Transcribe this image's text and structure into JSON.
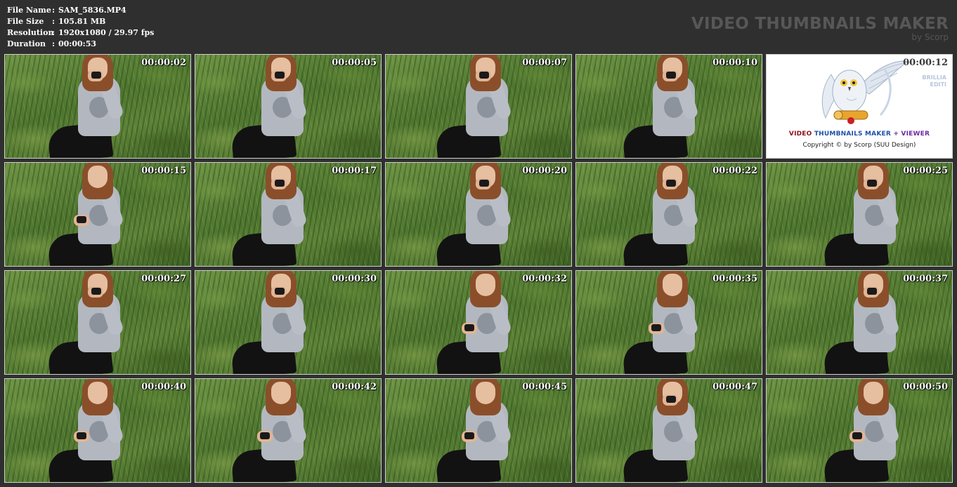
{
  "info": {
    "rows": [
      {
        "label": "File Name",
        "sep": ":",
        "value": "SAM_5836.MP4"
      },
      {
        "label": "File Size",
        "sep": ":",
        "value": "105.81 MB"
      },
      {
        "label": "Resolution",
        "sep": ":",
        "value": "1920x1080 / 29.97 fps"
      },
      {
        "label": "Duration",
        "sep": ":",
        "value": "00:00:53"
      }
    ]
  },
  "brand": {
    "title": "VIDEO THUMBNAILS MAKER",
    "subtitle": "by Scorp"
  },
  "logo_tile": {
    "title_part1": "VIDEO ",
    "title_part2": "THUMBNAILS MAKER ",
    "title_part3": "+ VIEWER",
    "copyright": "Copyright © by Scorp (SUU Design)",
    "side_line1": "BRILLIA",
    "side_line2": "EDITI",
    "mascot_icon": "owl-with-scroll-icon"
  },
  "thumbnails": [
    {
      "time": "00:00:02",
      "pose": "face"
    },
    {
      "time": "00:00:05",
      "pose": "face"
    },
    {
      "time": "00:00:07",
      "pose": "face"
    },
    {
      "time": "00:00:10",
      "pose": "face"
    },
    {
      "time": "00:00:12",
      "pose": "logo"
    },
    {
      "time": "00:00:15",
      "pose": "lap"
    },
    {
      "time": "00:00:17",
      "pose": "face"
    },
    {
      "time": "00:00:20",
      "pose": "face"
    },
    {
      "time": "00:00:22",
      "pose": "face"
    },
    {
      "time": "00:00:25",
      "pose": "face"
    },
    {
      "time": "00:00:27",
      "pose": "face"
    },
    {
      "time": "00:00:30",
      "pose": "face"
    },
    {
      "time": "00:00:32",
      "pose": "lap"
    },
    {
      "time": "00:00:35",
      "pose": "lap"
    },
    {
      "time": "00:00:37",
      "pose": "face"
    },
    {
      "time": "00:00:40",
      "pose": "lap"
    },
    {
      "time": "00:00:42",
      "pose": "lap"
    },
    {
      "time": "00:00:45",
      "pose": "lap"
    },
    {
      "time": "00:00:47",
      "pose": "face"
    },
    {
      "time": "00:00:50",
      "pose": "lap"
    }
  ],
  "colors": {
    "background": "#2f2f2f",
    "thumb_border": "#cfcfcf",
    "brand_text": "#575757"
  }
}
